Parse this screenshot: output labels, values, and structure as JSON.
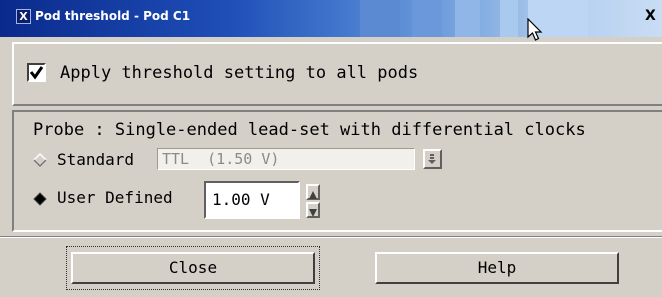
{
  "window": {
    "app_icon": "X",
    "title": "Pod threshold - Pod C1",
    "close_glyph": "X"
  },
  "options": {
    "apply_all_label": "Apply threshold setting to all pods",
    "apply_all_checked": true
  },
  "probe": {
    "label": "Probe : Single-ended lead-set with differential clocks"
  },
  "standard": {
    "label": "Standard",
    "value": "TTL  (1.50 V)",
    "selected": false
  },
  "user_defined": {
    "label": "User Defined",
    "value": "1.00 V",
    "selected": true
  },
  "buttons": {
    "close_label": "Close",
    "help_label": "Help"
  },
  "icons": {
    "app": "x-app-icon",
    "close": "close-icon",
    "cursor": "mouse-cursor-icon",
    "dropdown": "dropdown-arrow-icon",
    "spin_up": "spin-up-icon",
    "spin_down": "spin-down-icon"
  },
  "colors": {
    "title_start": "#0a2a8c",
    "title_end": "#c9dcf4",
    "dialog_bg": "#d4d0c8"
  }
}
